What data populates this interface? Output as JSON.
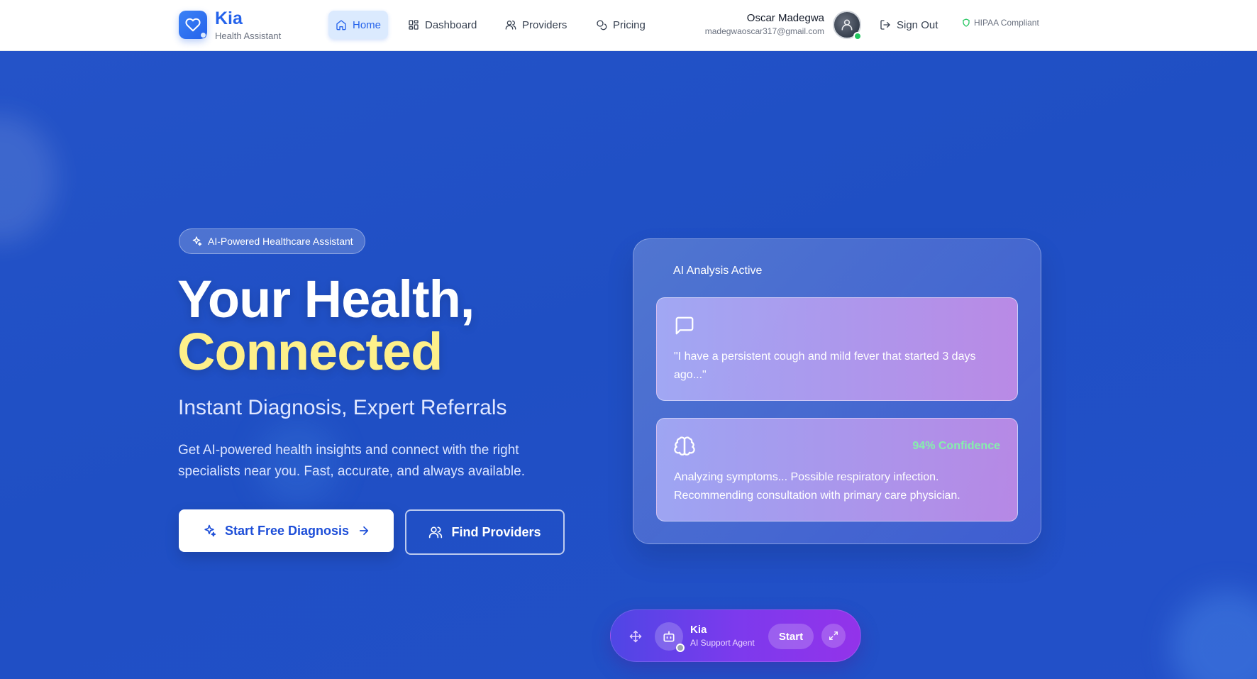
{
  "header": {
    "brand_name": "Kia",
    "brand_sub": "Health Assistant",
    "nav": [
      {
        "label": "Home",
        "icon": "home-icon",
        "active": true
      },
      {
        "label": "Dashboard",
        "icon": "dashboard-icon"
      },
      {
        "label": "Providers",
        "icon": "users-icon"
      },
      {
        "label": "Pricing",
        "icon": "coins-icon"
      }
    ],
    "user_name": "Oscar Madegwa",
    "user_email": "madegwaoscar317@gmail.com",
    "signout_label": "Sign Out",
    "hipaa_label": "HIPAA Compliant"
  },
  "hero": {
    "badge": "AI-Powered Healthcare Assistant",
    "title_line1": "Your Health,",
    "title_line2": "Connected",
    "subtitle": "Instant Diagnosis, Expert Referrals",
    "description": "Get AI-powered health insights and connect with the right specialists near you. Fast, accurate, and always available.",
    "primary_button": "Start Free Diagnosis",
    "secondary_button": "Find Providers"
  },
  "ai_card": {
    "status": "AI Analysis Active",
    "user_message": "\"I have a persistent cough and mild fever that started 3 days ago...\"",
    "confidence": "94% Confidence",
    "analysis": "Analyzing symptoms... Possible respiratory infection. Recommending consultation with primary care physician."
  },
  "agent": {
    "name": "Kia",
    "role": "AI Support Agent",
    "start_label": "Start"
  },
  "colors": {
    "brand": "#2563eb",
    "hero_bg": "#1f4fc4",
    "accent_yellow": "#fef08a",
    "confidence_green": "#86efac",
    "agent_gradient": [
      "#4f46e5",
      "#9333ea"
    ]
  }
}
